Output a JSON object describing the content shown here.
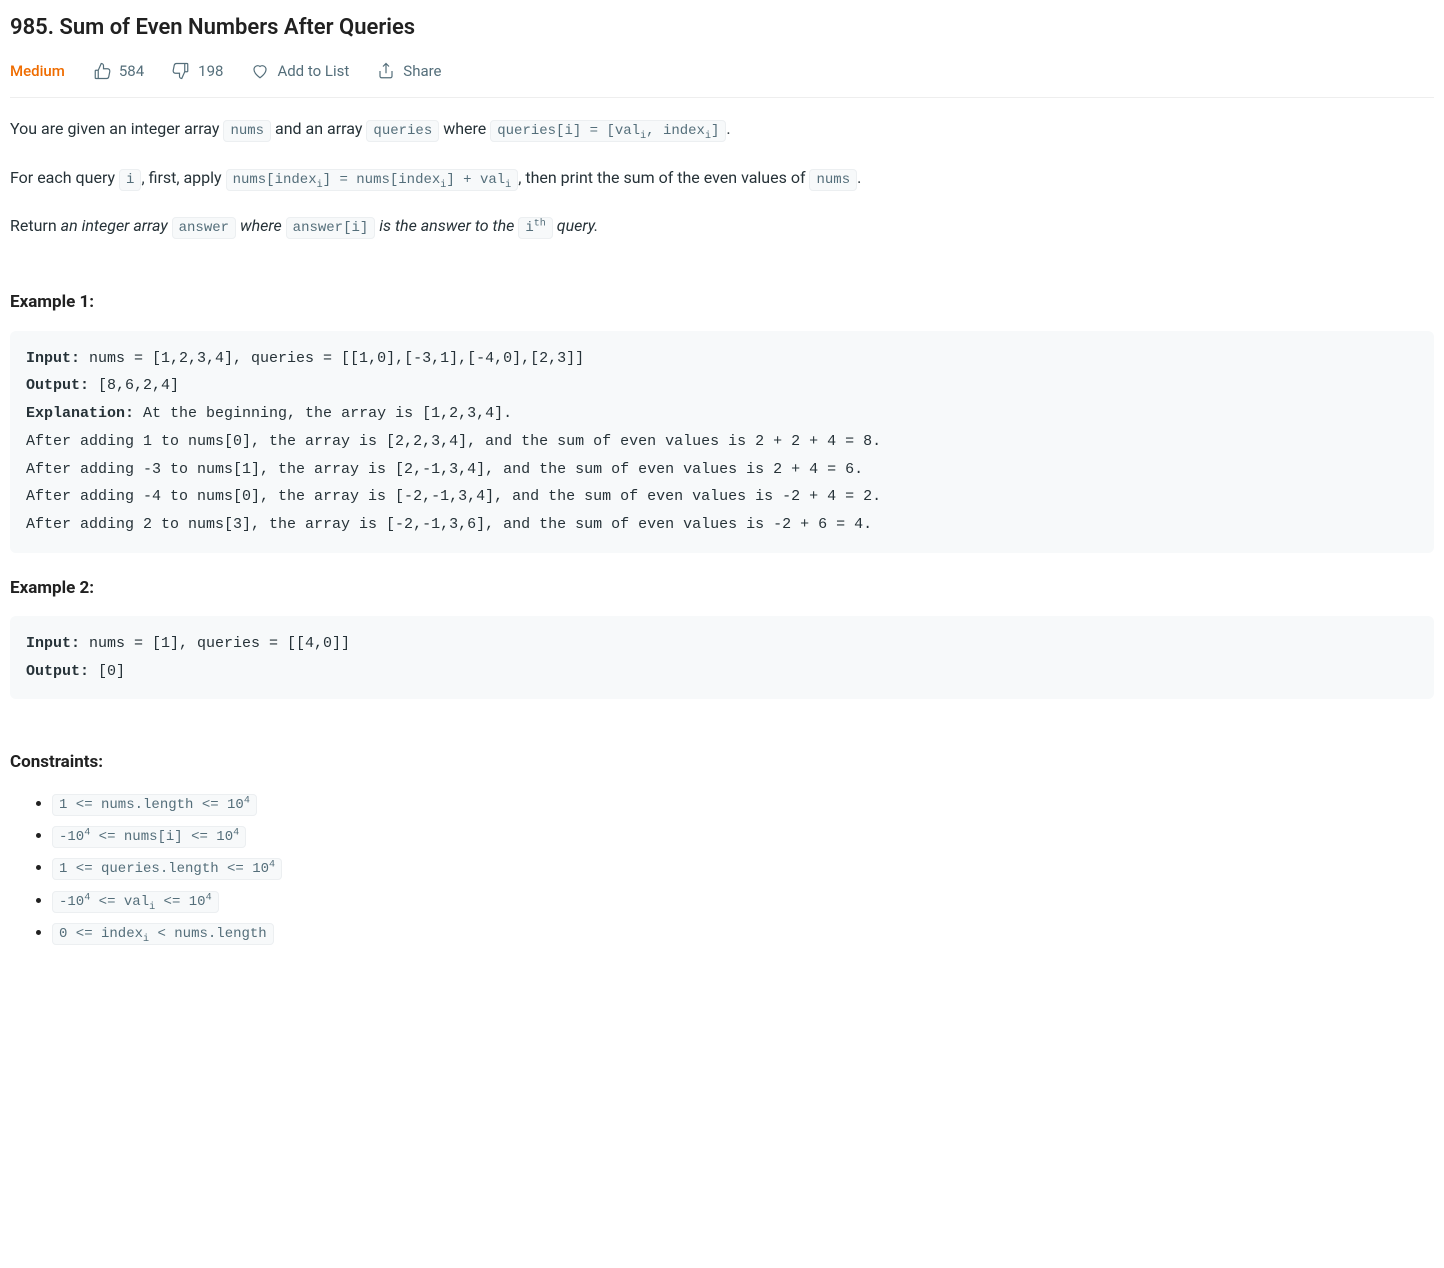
{
  "title": "985. Sum of Even Numbers After Queries",
  "meta": {
    "difficulty": "Medium",
    "likes": "584",
    "dislikes": "198",
    "add_to_list": "Add to List",
    "share": "Share"
  },
  "desc": {
    "p1_a": "You are given an integer array ",
    "p1_code1": "nums",
    "p1_b": " and an array ",
    "p1_code2": "queries",
    "p1_c": " where ",
    "p1_code3_html": "queries[i] = [val<sub>i</sub>, index<sub>i</sub>]",
    "p1_d": ".",
    "p2_a": "For each query ",
    "p2_code1": "i",
    "p2_b": ", first, apply ",
    "p2_code2_html": "nums[index<sub>i</sub>] = nums[index<sub>i</sub>] + val<sub>i</sub>",
    "p2_c": ", then print the sum of the even values of ",
    "p2_code3": "nums",
    "p2_d": ".",
    "p3_a": "Return ",
    "p3_em1": "an integer array ",
    "p3_code1": "answer",
    "p3_em2": " where ",
    "p3_code2": "answer[i]",
    "p3_em3": " is the answer to the ",
    "p3_code3_html": "i<sup>th</sup>",
    "p3_em4": " query."
  },
  "ex1": {
    "heading": "Example 1:",
    "input_label": "Input:",
    "input_text": " nums = [1,2,3,4], queries = [[1,0],[-3,1],[-4,0],[2,3]]",
    "output_label": "Output:",
    "output_text": " [8,6,2,4]",
    "expl_label": "Explanation:",
    "expl_text": " At the beginning, the array is [1,2,3,4].\nAfter adding 1 to nums[0], the array is [2,2,3,4], and the sum of even values is 2 + 2 + 4 = 8.\nAfter adding -3 to nums[1], the array is [2,-1,3,4], and the sum of even values is 2 + 4 = 6.\nAfter adding -4 to nums[0], the array is [-2,-1,3,4], and the sum of even values is -2 + 4 = 2.\nAfter adding 2 to nums[3], the array is [-2,-1,3,6], and the sum of even values is -2 + 6 = 4."
  },
  "ex2": {
    "heading": "Example 2:",
    "input_label": "Input:",
    "input_text": " nums = [1], queries = [[4,0]]",
    "output_label": "Output:",
    "output_text": " [0]"
  },
  "constraints": {
    "heading": "Constraints:",
    "items_html": [
      "1 <= nums.length <= 10<sup>4</sup>",
      "-10<sup>4</sup> <= nums[i] <= 10<sup>4</sup>",
      "1 <= queries.length <= 10<sup>4</sup>",
      "-10<sup>4</sup> <= val<sub>i</sub> <= 10<sup>4</sup>",
      "0 <= index<sub>i</sub> < nums.length"
    ]
  }
}
